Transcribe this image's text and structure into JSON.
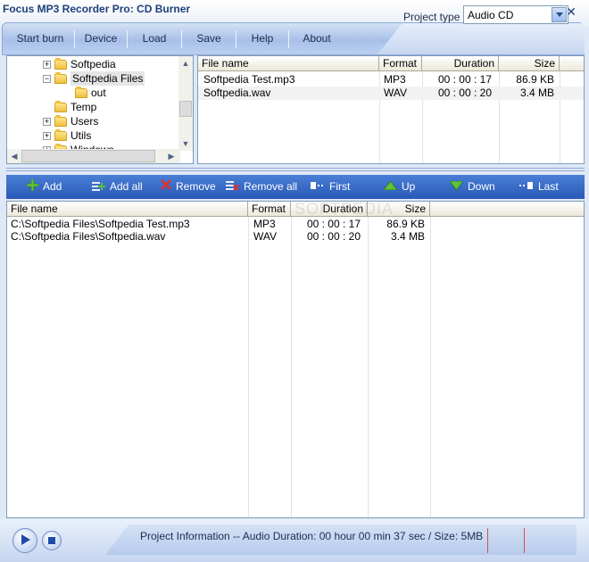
{
  "window": {
    "title": "Focus MP3 Recorder Pro: CD Burner"
  },
  "menu": {
    "items": [
      {
        "label": "Start burn"
      },
      {
        "label": "Device"
      },
      {
        "label": "Load"
      },
      {
        "label": "Save"
      },
      {
        "label": "Help"
      },
      {
        "label": "About"
      }
    ],
    "project_type_label": "Project type",
    "project_type_value": "Audio CD"
  },
  "tree": {
    "items": [
      {
        "label": "Softpedia",
        "expander": "+"
      },
      {
        "label": "Softpedia Files",
        "expander": "−"
      },
      {
        "label": "out",
        "expander": ""
      },
      {
        "label": "Temp",
        "expander": ""
      },
      {
        "label": "Users",
        "expander": "+"
      },
      {
        "label": "Utils",
        "expander": "+"
      },
      {
        "label": "Windows",
        "expander": "+"
      }
    ]
  },
  "files_top": {
    "headers": [
      "File name",
      "Format",
      "Duration",
      "Size"
    ],
    "rows": [
      {
        "name": "Softpedia Test.mp3",
        "format": "MP3",
        "duration": "00 : 00 : 17",
        "size": "86.9 KB"
      },
      {
        "name": "Softpedia.wav",
        "format": "WAV",
        "duration": "00 : 00 : 20",
        "size": "3.4 MB"
      }
    ]
  },
  "actions": {
    "add": "Add",
    "add_all": "Add all",
    "remove": "Remove",
    "remove_all": "Remove all",
    "first": "First",
    "up": "Up",
    "down": "Down",
    "last": "Last"
  },
  "burn_list": {
    "headers": [
      "File name",
      "Format",
      "Duration",
      "Size"
    ],
    "rows": [
      {
        "name": "C:\\Softpedia Files\\Softpedia Test.mp3",
        "format": "MP3",
        "duration": "00 : 00 : 17",
        "size": "86.9 KB"
      },
      {
        "name": "C:\\Softpedia Files\\Softpedia.wav",
        "format": "WAV",
        "duration": "00 : 00 : 20",
        "size": "3.4 MB"
      }
    ]
  },
  "status": {
    "project_info": "Project Information -- Audio Duration: 00 hour 00 min 37 sec  /  Size: 5MB"
  },
  "watermark": "SOFTPEDIA",
  "colors": {
    "toolbar_blue": "#2a59b8",
    "accent": "#1e3f7c"
  }
}
